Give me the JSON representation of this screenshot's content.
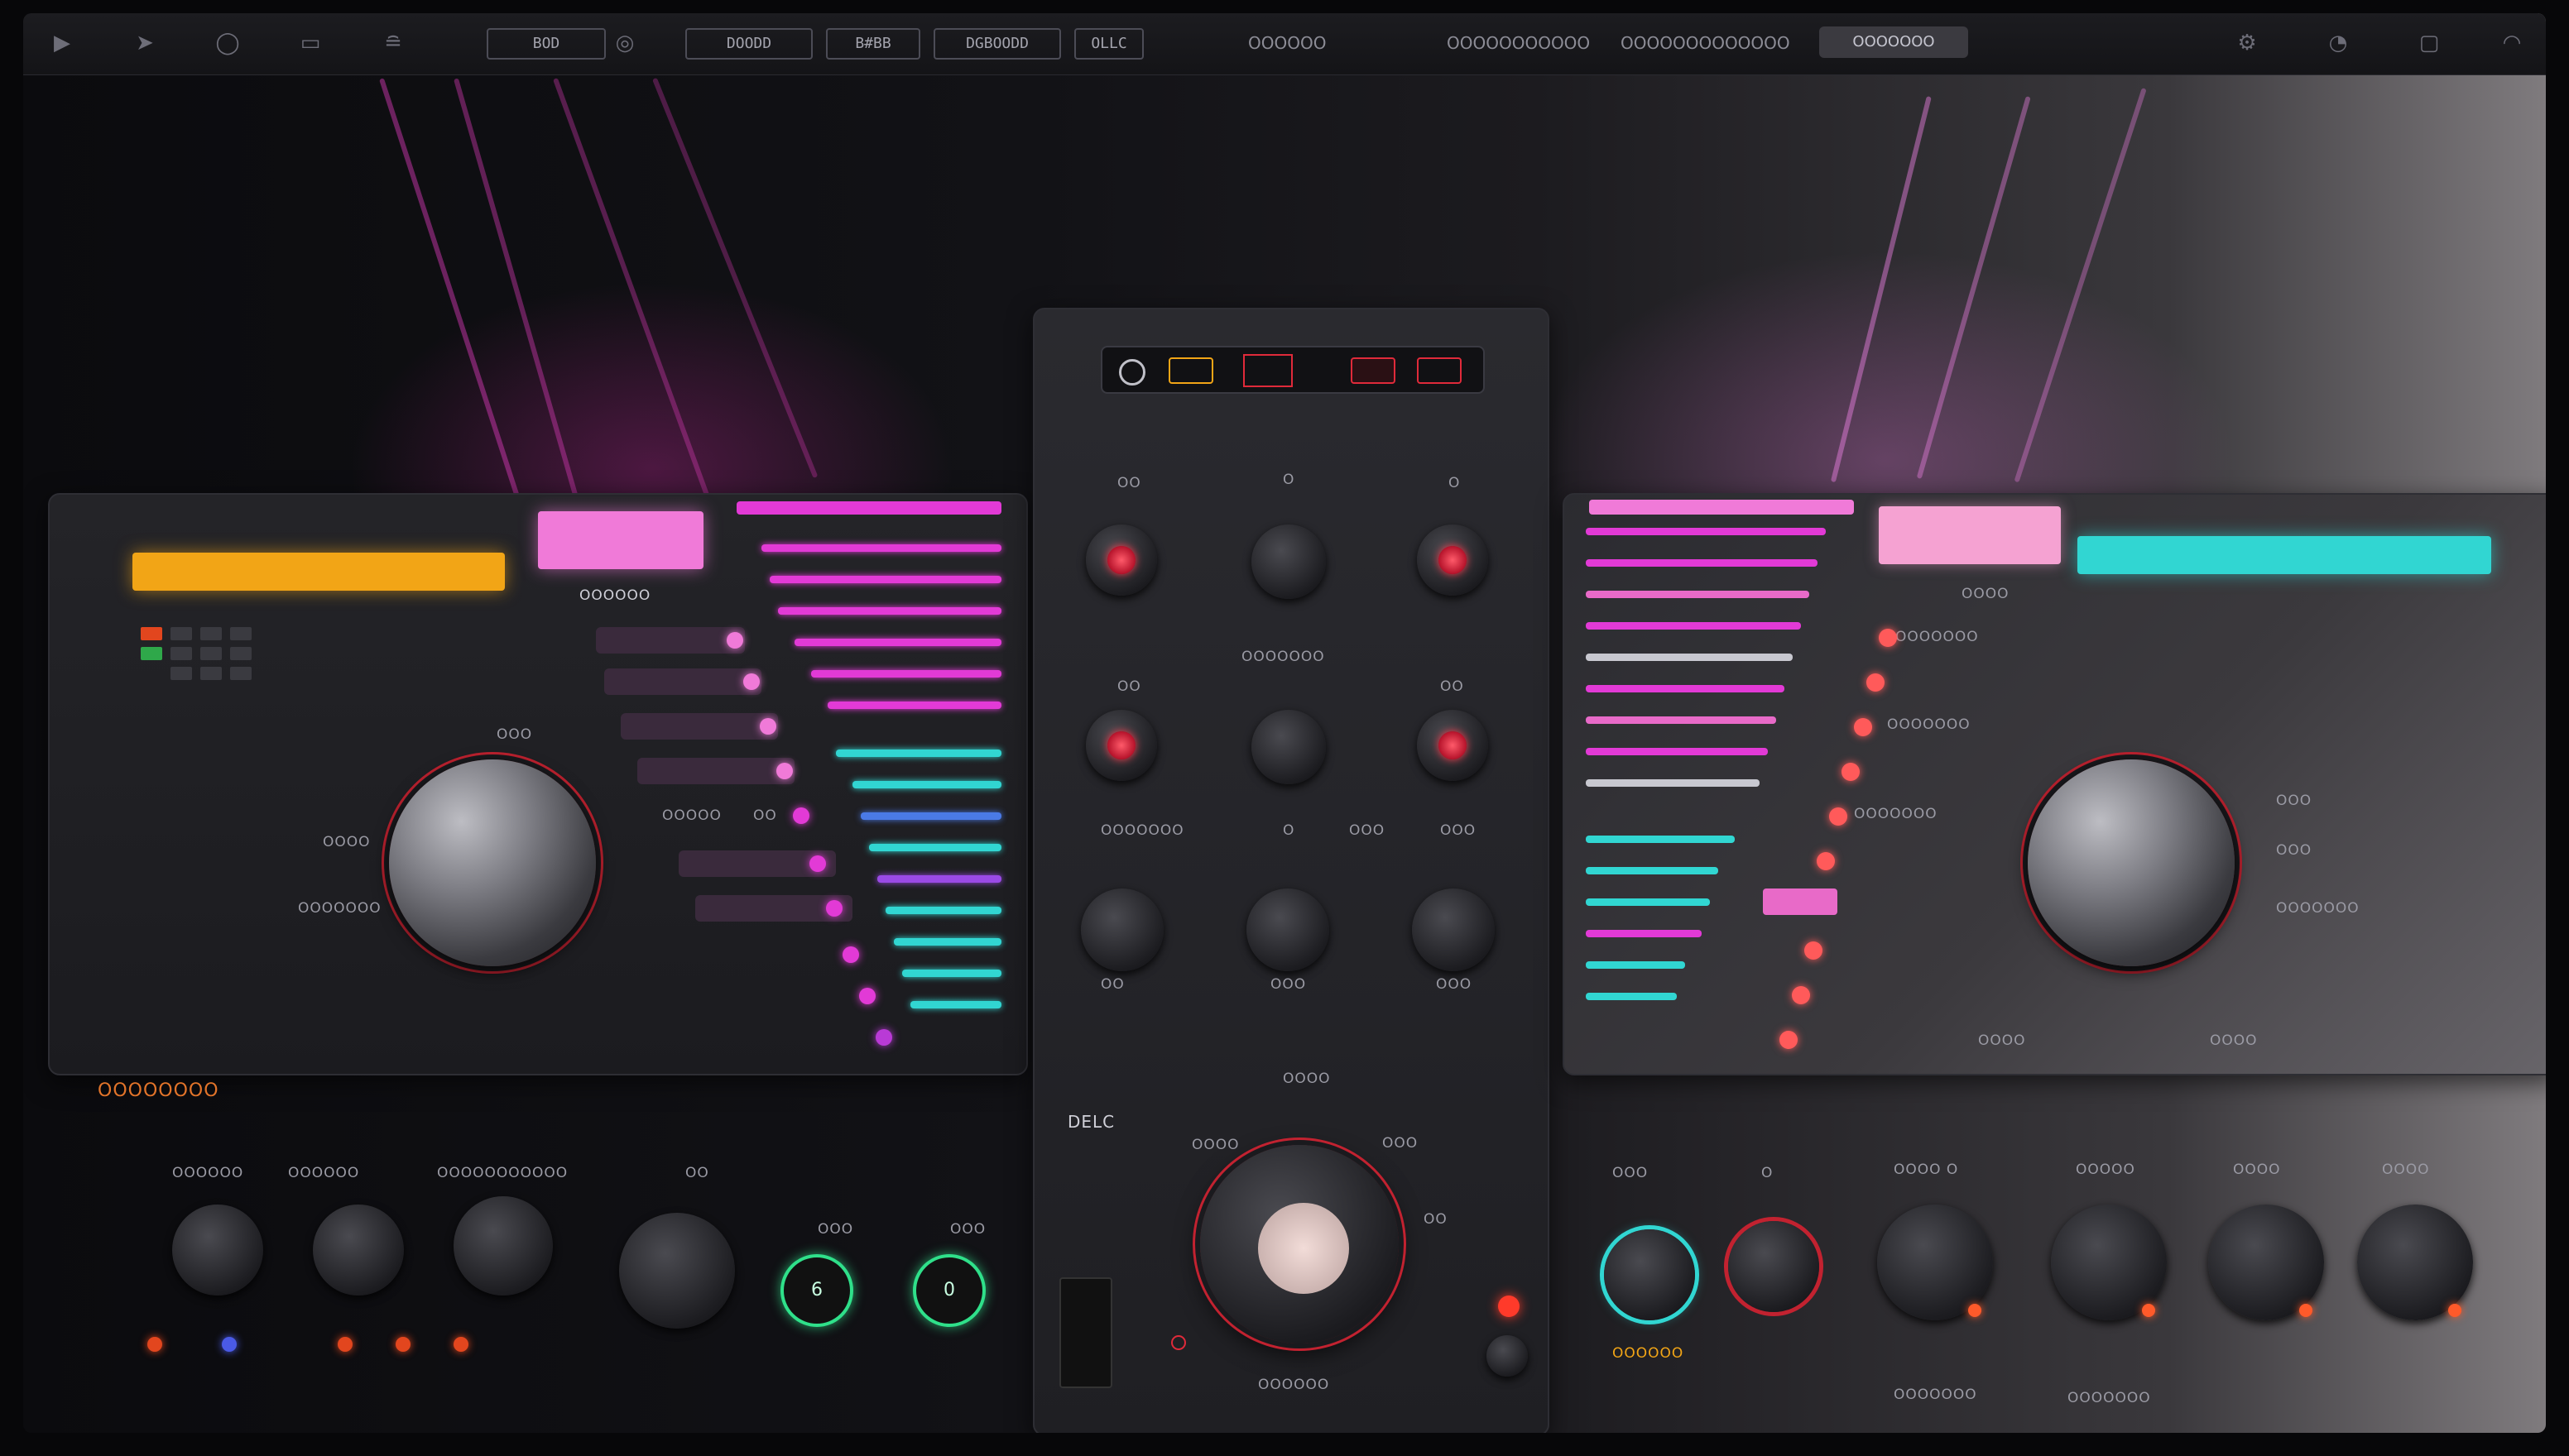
{
  "toolbar": {
    "icons": [
      "play-icon",
      "forward-icon",
      "loop-icon",
      "window-icon",
      "mixer-icon",
      "record-icon"
    ],
    "boxes": [
      "BOD",
      "DOODD",
      "B#BB",
      "DGBOODD",
      "OLLC"
    ],
    "center_label": "OOOOOO",
    "right_labels": [
      "OOOOOOOOOOO",
      "OOOOOOOOOOOOO"
    ],
    "pill_label": "OOOOOOO",
    "right_icons": [
      "settings-icon",
      "account-icon",
      "window-icon",
      "wave-icon"
    ]
  },
  "left_panel": {
    "list_heading": "OOOOOO",
    "knob_labels": [
      "OOOO",
      "OOOOOOO",
      "OOO"
    ],
    "row_labels": [
      "OOOOO",
      "OO"
    ],
    "bottom_title": "OOOOOOOO",
    "bottom_labels": [
      "OOOOOO",
      "OOOOOO",
      "OOOOOOOOOOO",
      "OO",
      "OOO",
      "OOO"
    ],
    "button_a": "6",
    "button_b": "0"
  },
  "center_panel": {
    "tiny_labels": [
      "OO",
      "O",
      "O",
      "OOOOOOO",
      "OO",
      "OO",
      "OOOOOOO",
      "O",
      "OOO",
      "OOO",
      "OO",
      "OOO",
      "OOO",
      "OOOO"
    ],
    "section_label": "DELC",
    "main_knob_labels": [
      "OOOO",
      "OOO",
      "OO"
    ],
    "footer_label": "OOOOOO"
  },
  "right_panel": {
    "channel_labels": [
      "OOOO",
      "OOOOOOO",
      "OOOOOOO",
      "OOOOOOO"
    ],
    "knob_labels": [
      "OOO",
      "OOOOOOO",
      "OOO"
    ],
    "footer_labels": [
      "OOOO",
      "OOOO"
    ],
    "bottom_labels": [
      "OOO",
      "O",
      "OOOO O",
      "OOOOO",
      "OOOO",
      "OOOO"
    ],
    "bottom_small": "OOOOOO",
    "bottom_foot": [
      "OOOOOOO",
      "OOOOOOO"
    ]
  },
  "colors": {
    "magenta": "#e23ad6",
    "pink": "#f47ad6",
    "cyan": "#31d6d2",
    "orange": "#f2a516",
    "red": "#e02a3a",
    "green": "#2fe08a"
  }
}
